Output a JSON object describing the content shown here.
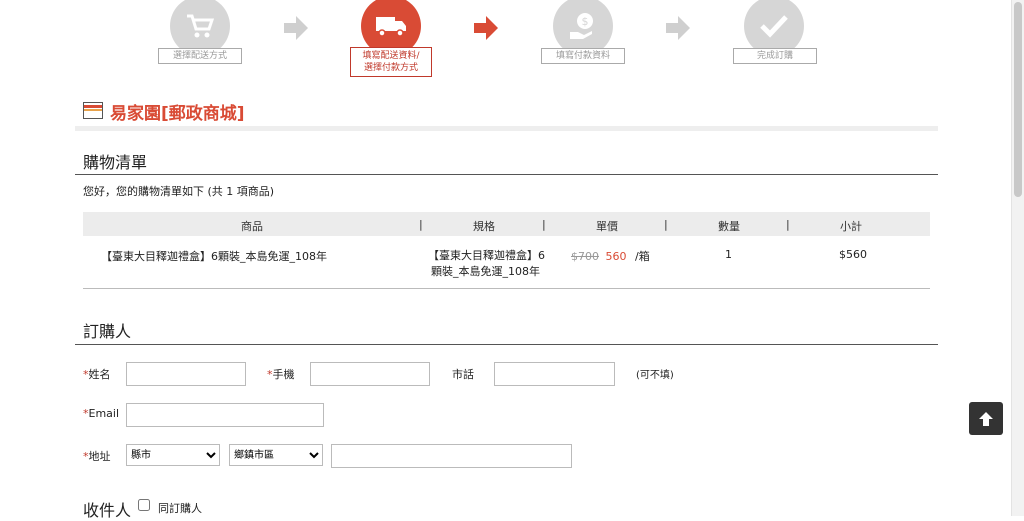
{
  "steps": [
    {
      "label": "選擇配送方式",
      "icon": "cart-icon"
    },
    {
      "label_line1": "填寫配送資料/",
      "label_line2": "選擇付款方式",
      "icon": "truck-icon"
    },
    {
      "label": "填寫付款資料",
      "icon": "money-icon"
    },
    {
      "label": "完成訂購",
      "icon": "check-icon"
    }
  ],
  "store": {
    "name": "易家園[郵政商城]"
  },
  "cart": {
    "title": "購物清單",
    "greeting": "您好，您的購物清單如下 (共 1 項商品)",
    "headers": {
      "product": "商品",
      "spec": "規格",
      "price": "單價",
      "qty": "數量",
      "subtotal": "小計",
      "sep": "|"
    },
    "rows": [
      {
        "product": "【臺東大目釋迦禮盒】6顆裝_本島免運_108年",
        "spec_line1": "【臺東大目釋迦禮盒】6",
        "spec_line2": "顆裝_本島免運_108年",
        "old_price": "$700",
        "price": "560",
        "unit": "/箱",
        "qty": "1",
        "subtotal": "$560"
      }
    ]
  },
  "buyer": {
    "title": "訂購人",
    "required_mark": "*",
    "name_label": "姓名",
    "mobile_label": "手機",
    "phone_label": "市話",
    "optional_note": "(可不填)",
    "email_label": "Email",
    "address_label": "地址",
    "city_option": "縣市",
    "district_option": "鄉鎮市區"
  },
  "recipient": {
    "title": "收件人",
    "same_as_buyer": "同訂購人"
  },
  "colors": {
    "accent": "#d94b35",
    "step_inactive": "#d6d6d6"
  }
}
